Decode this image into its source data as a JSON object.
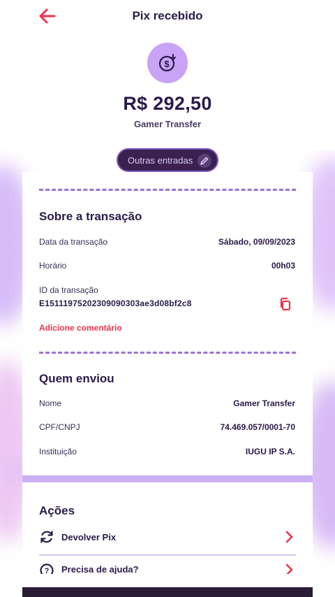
{
  "header": {
    "title": "Pix recebido"
  },
  "summary": {
    "amount": "R$ 292,50",
    "sender_name": "Gamer Transfer",
    "chip_label": "Outras entradas"
  },
  "transaction": {
    "section_title": "Sobre a transação",
    "rows": [
      {
        "label": "Data da transação",
        "value": "Sábado, 09/09/2023"
      },
      {
        "label": "Horário",
        "value": "00h03"
      }
    ],
    "id_label": "ID da transação",
    "id_value": "E15111975202309090303ae3d08bf2c8",
    "add_comment": "Adicione comentário"
  },
  "sender": {
    "section_title": "Quem enviou",
    "rows": [
      {
        "label": "Nome",
        "value": "Gamer Transfer"
      },
      {
        "label": "CPF/CNPJ",
        "value": "74.469.057/0001-70"
      },
      {
        "label": "Instituição",
        "value": "IUGU IP S.A."
      }
    ]
  },
  "actions": {
    "section_title": "Ações",
    "items": [
      {
        "label": "Devolver Pix",
        "icon": "refresh-icon"
      },
      {
        "label": "Precisa de ajuda?",
        "icon": "help-icon"
      }
    ]
  },
  "colors": {
    "accent": "#f0324a",
    "primary_text": "#2a1a4a",
    "lavender": "#c9a3f6",
    "chip_bg": "#3a2150"
  }
}
